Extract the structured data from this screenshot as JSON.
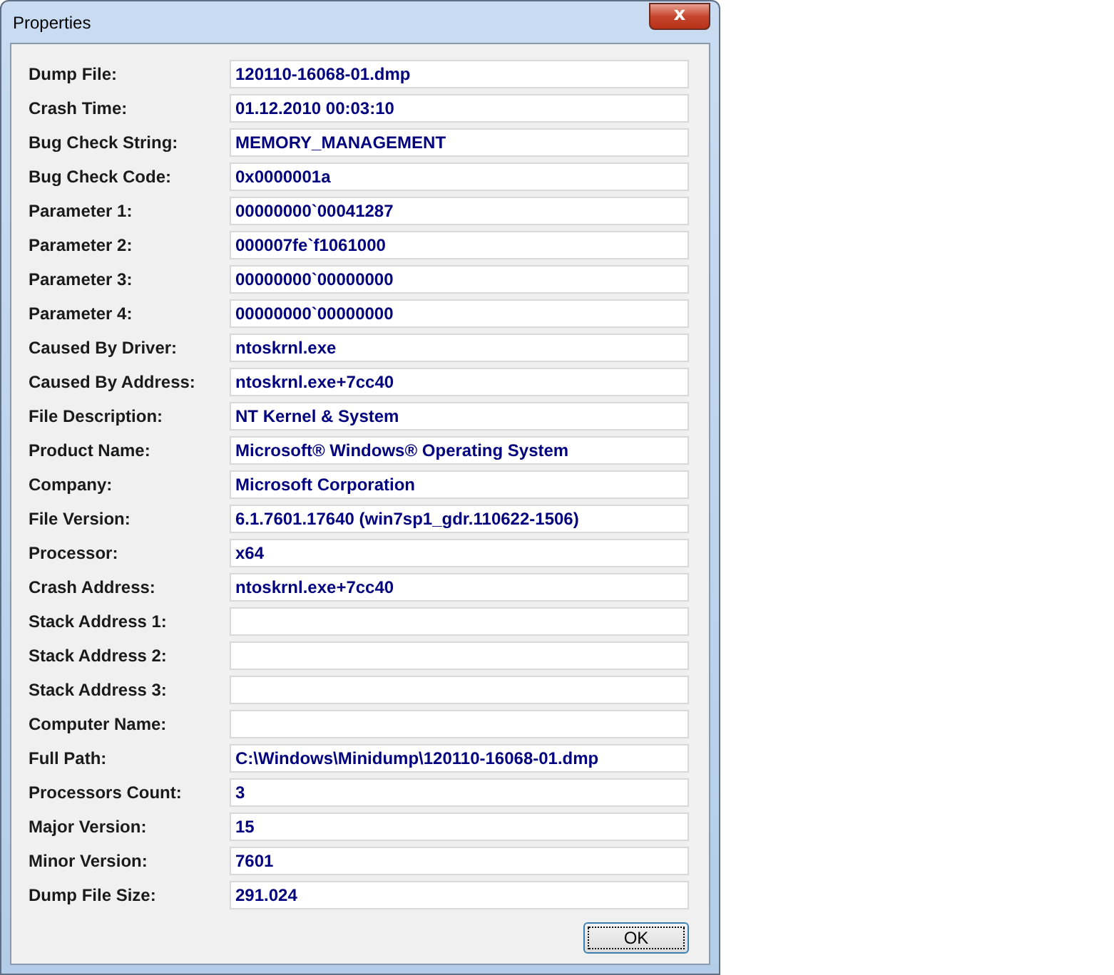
{
  "window": {
    "title": "Properties",
    "close_label": "x"
  },
  "fields": [
    {
      "label": "Dump File:",
      "value": "120110-16068-01.dmp"
    },
    {
      "label": "Crash Time:",
      "value": "01.12.2010 00:03:10"
    },
    {
      "label": "Bug Check String:",
      "value": "MEMORY_MANAGEMENT"
    },
    {
      "label": "Bug Check Code:",
      "value": "0x0000001a"
    },
    {
      "label": "Parameter 1:",
      "value": "00000000`00041287"
    },
    {
      "label": "Parameter 2:",
      "value": "000007fe`f1061000"
    },
    {
      "label": "Parameter 3:",
      "value": "00000000`00000000"
    },
    {
      "label": "Parameter 4:",
      "value": "00000000`00000000"
    },
    {
      "label": "Caused By Driver:",
      "value": "ntoskrnl.exe"
    },
    {
      "label": "Caused By Address:",
      "value": "ntoskrnl.exe+7cc40"
    },
    {
      "label": "File Description:",
      "value": "NT Kernel & System"
    },
    {
      "label": "Product Name:",
      "value": "Microsoft® Windows® Operating System"
    },
    {
      "label": "Company:",
      "value": "Microsoft Corporation"
    },
    {
      "label": "File Version:",
      "value": "6.1.7601.17640 (win7sp1_gdr.110622-1506)"
    },
    {
      "label": "Processor:",
      "value": "x64"
    },
    {
      "label": "Crash Address:",
      "value": "ntoskrnl.exe+7cc40"
    },
    {
      "label": "Stack Address 1:"
    },
    {
      "label": "Stack Address 2:"
    },
    {
      "label": "Stack Address 3:"
    },
    {
      "label": "Computer Name:"
    },
    {
      "label": "Full Path:",
      "value": "C:\\Windows\\Minidump\\120110-16068-01.dmp"
    },
    {
      "label": "Processors Count:",
      "value": "3"
    },
    {
      "label": "Major Version:",
      "value": "15"
    },
    {
      "label": "Minor Version:",
      "value": "7601"
    },
    {
      "label": "Dump File Size:",
      "value": "291.024"
    }
  ],
  "buttons": [
    "OK"
  ]
}
